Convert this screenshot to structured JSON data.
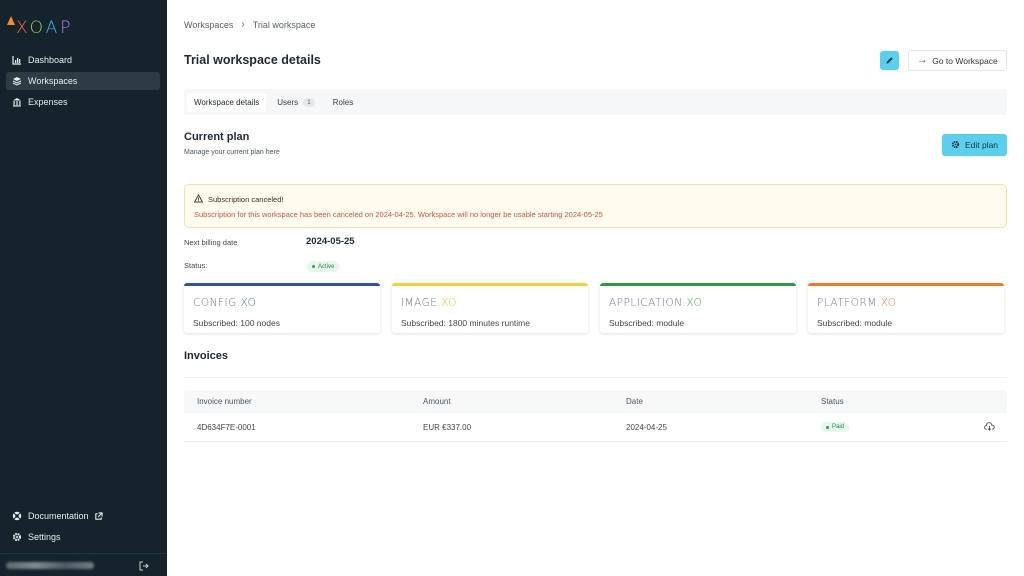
{
  "brand": {
    "logo_text": "XOAP"
  },
  "sidebar": {
    "items": [
      {
        "label": "Dashboard",
        "icon": "chart-icon"
      },
      {
        "label": "Workspaces",
        "icon": "layers-icon"
      },
      {
        "label": "Expenses",
        "icon": "bank-icon"
      }
    ],
    "bottom_items": [
      {
        "label": "Documentation",
        "icon": "help-icon"
      },
      {
        "label": "Settings",
        "icon": "gear-icon"
      }
    ]
  },
  "breadcrumb": {
    "root": "Workspaces",
    "current": "Trial workspace"
  },
  "page": {
    "title": "Trial workspace details",
    "goto_label": "Go to Workspace"
  },
  "tabs": [
    {
      "label": "Workspace details"
    },
    {
      "label": "Users",
      "count": "1"
    },
    {
      "label": "Roles"
    }
  ],
  "plan": {
    "title": "Current plan",
    "subtitle": "Manage your current plan here",
    "edit_label": "Edit plan"
  },
  "alert": {
    "title": "Subscription canceled!",
    "message": "Subscription for this workspace has been canceled on 2024-04-25. Workspace will no longer be usable starting 2024-05-25"
  },
  "billing": {
    "next_label": "Next billing date",
    "next_value": "2024-05-25",
    "status_label": "Status:",
    "status_value": "Active"
  },
  "products": [
    {
      "name_main": "CONFIG.",
      "name_xo": "XO",
      "subscribed": "Subscribed: 100 nodes",
      "color": "#2f52a8",
      "xo_color": "#3b6fd6"
    },
    {
      "name_main": "IMAGE.",
      "name_xo": "XO",
      "subscribed": "Subscribed: 1800 minutes runtime",
      "color": "#f2d233",
      "xo_color": "#e7c31e"
    },
    {
      "name_main": "APPLICATION.",
      "name_xo": "XO",
      "subscribed": "Subscribed: module",
      "color": "#2e9a3e",
      "xo_color": "#3aa54a"
    },
    {
      "name_main": "PLATFORM.",
      "name_xo": "XO",
      "subscribed": "Subscribed: module",
      "color": "#f07a22",
      "xo_color": "#f07a22"
    }
  ],
  "invoices": {
    "title": "Invoices",
    "columns": [
      "Invoice number",
      "Amount",
      "Date",
      "Status"
    ],
    "rows": [
      {
        "number": "4D634F7E-0001",
        "amount": "EUR €337.00",
        "date": "2024-04-25",
        "status": "Paid"
      }
    ]
  }
}
